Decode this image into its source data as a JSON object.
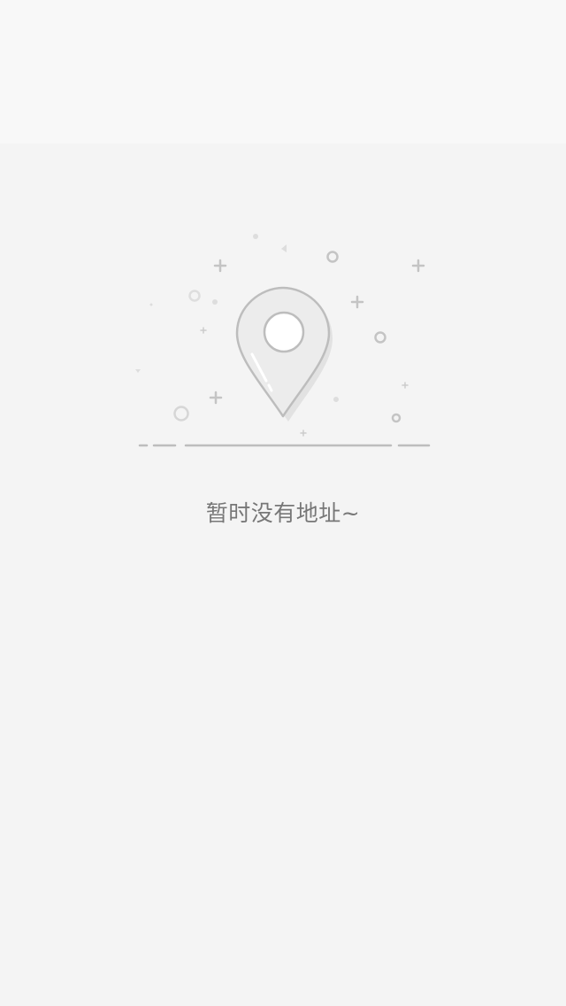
{
  "empty_state": {
    "message": "暂时没有地址~",
    "illustration_icon": "location-pin-icon"
  },
  "colors": {
    "background": "#f4f4f4",
    "header_background": "#f8f8f8",
    "text": "#777777",
    "illustration_stroke": "#bdbdbd",
    "pin_fill": "#ececec"
  }
}
